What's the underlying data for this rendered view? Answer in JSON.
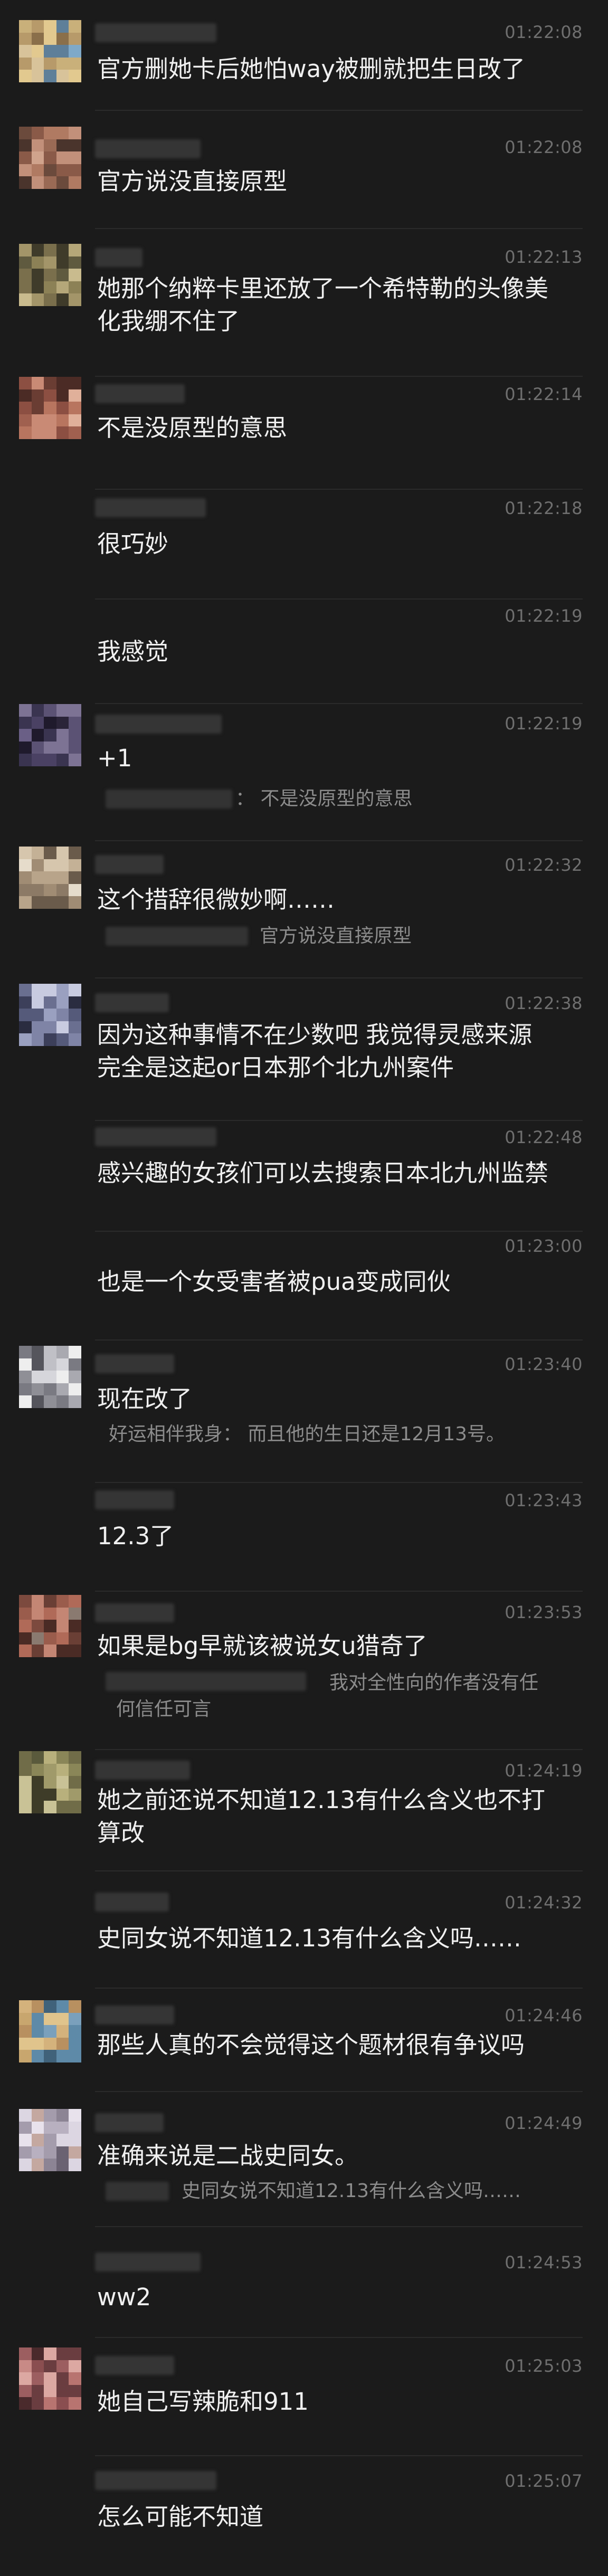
{
  "messages": [
    {
      "time": "01:22:08",
      "text": "官方删她卡后她怕way被删就把生日改了"
    },
    {
      "time": "01:22:08",
      "text": "官方说没直接原型"
    },
    {
      "time": "01:22:13",
      "text": "她那个纳粹卡里还放了一个希特勒的头像美\n化我绷不住了"
    },
    {
      "time": "01:22:14",
      "text": "不是没原型的意思"
    },
    {
      "time": "01:22:18",
      "text": "很巧妙"
    },
    {
      "time": "01:22:19",
      "text": "我感觉"
    },
    {
      "time": "01:22:19",
      "text": "+1",
      "reply": "：  不是没原型的意思"
    },
    {
      "time": "01:22:32",
      "text": "这个措辞很微妙啊……",
      "reply": "官方说没直接原型"
    },
    {
      "time": "01:22:38",
      "text": "因为这种事情不在少数吧 我觉得灵感来源\n完全是这起or日本那个北九州案件"
    },
    {
      "time": "01:22:48",
      "text": "感兴趣的女孩们可以去搜索日本北九州监禁"
    },
    {
      "time": "01:23:00",
      "text": "也是一个女受害者被pua变成同伙"
    },
    {
      "time": "01:23:40",
      "text": "现在改了",
      "reply": "好运相伴我身：  而且他的生日还是12月13号。"
    },
    {
      "time": "01:23:43",
      "text": "12.3了"
    },
    {
      "time": "01:23:53",
      "text": "如果是bg早就该被说女u猎奇了",
      "reply": "我对全性向的作者没有任",
      "reply_line2": "何信任可言"
    },
    {
      "time": "01:24:19",
      "text": "她之前还说不知道12.13有什么含义也不打\n算改"
    },
    {
      "time": "01:24:32",
      "text": "史同女说不知道12.13有什么含义吗……"
    },
    {
      "time": "01:24:46",
      "text": "那些人真的不会觉得这个题材很有争议吗"
    },
    {
      "time": "01:24:49",
      "text": "准确来说是二战史同女。",
      "reply": "史同女说不知道12.13有什么含义吗……"
    },
    {
      "time": "01:24:53",
      "text": "ww2"
    },
    {
      "time": "01:25:03",
      "text": "她自己写辣脆和911"
    },
    {
      "time": "01:25:07",
      "text": "怎么可能不知道"
    }
  ]
}
